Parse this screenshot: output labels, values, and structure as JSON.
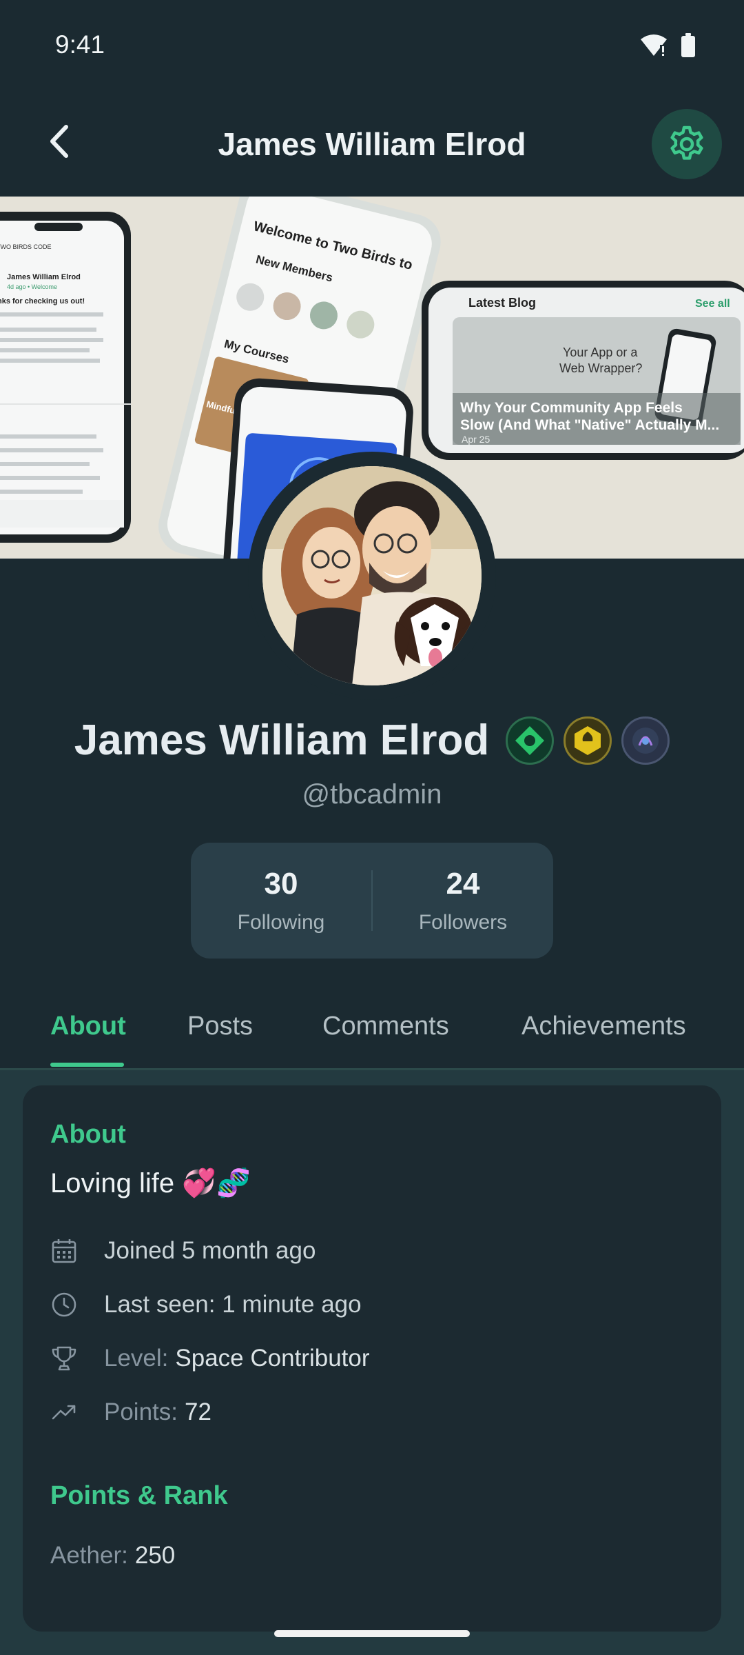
{
  "status_bar": {
    "time": "9:41"
  },
  "app_bar": {
    "title": "James William Elrod"
  },
  "banner": {
    "blog_header": "Latest Blog",
    "see_all": "See all",
    "blog_title_line1": "Why Your Community App Feels",
    "blog_title_line2": "Slow (And What \"Native\" Actually M...",
    "blog_date": "Apr 25",
    "phone_welcome": "Welcome to Two Birds to",
    "new_members": "New Members",
    "my_courses": "My Courses",
    "course_name": "Mindfulness Basics",
    "post_author": "James William Elrod",
    "post_meta": "4d ago • Welcome",
    "post_text": "nks for checking us out!",
    "brand": "TWO BIRDS CODE",
    "wrapper_q1": "Your App or a",
    "wrapper_q2": "Web Wrapper?"
  },
  "profile": {
    "name": "James William Elrod",
    "handle": "@tbcadmin",
    "following_count": "30",
    "following_label": "Following",
    "followers_count": "24",
    "followers_label": "Followers"
  },
  "tabs": [
    "About",
    "Posts",
    "Comments",
    "Achievements"
  ],
  "about": {
    "section_title": "About",
    "bio": "Loving life 💞🧬",
    "joined": "Joined 5 month ago",
    "last_seen": "Last seen: 1 minute ago",
    "level_label": "Level:",
    "level_value": "Space Contributor",
    "points_label": "Points:",
    "points_value": "72",
    "rank_title": "Points & Rank",
    "aether_label": "Aether:",
    "aether_value": "250"
  },
  "colors": {
    "accent": "#3fc98d",
    "background": "#1b2a31",
    "card": "#1c2a31"
  }
}
